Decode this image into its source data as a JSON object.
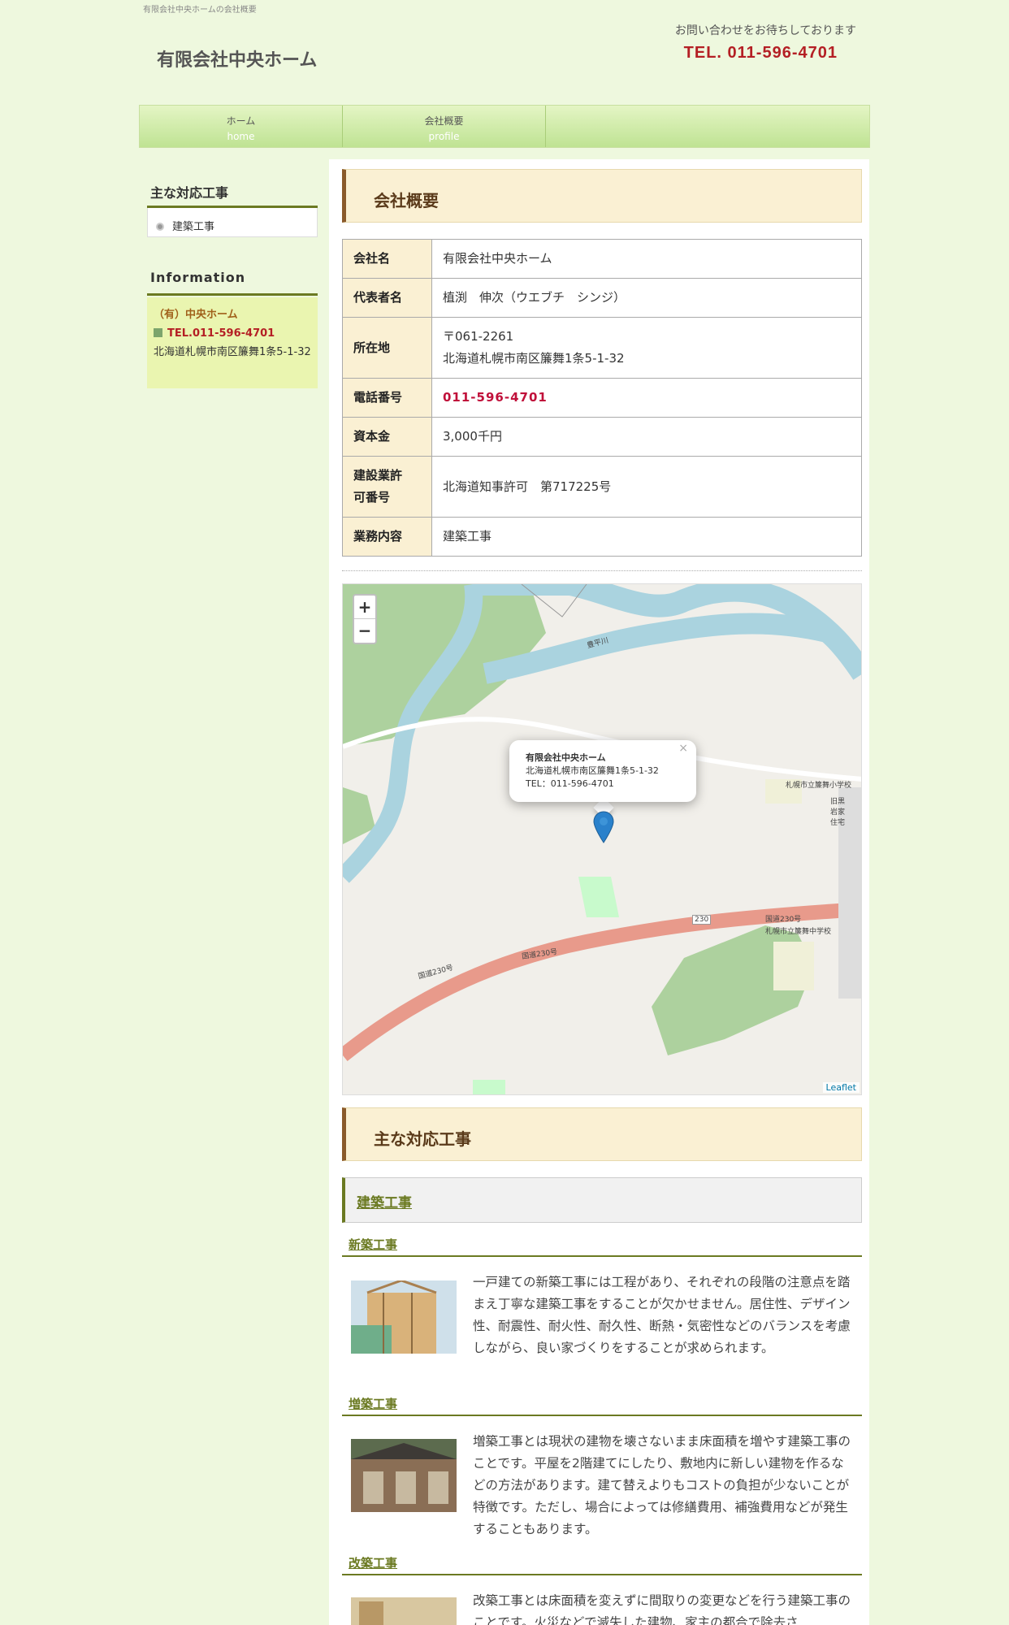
{
  "header": {
    "topline": "有限会社中央ホームの会社概要",
    "site_title": "有限会社中央ホーム",
    "contact_message": "お問い合わせをお待ちしております",
    "contact_tel": "TEL. 011-596-4701"
  },
  "nav": [
    {
      "label": "ホーム",
      "sub": "home"
    },
    {
      "label": "会社概要",
      "sub": "profile"
    }
  ],
  "sidebar": {
    "works_heading": "主な対応工事",
    "works_items": [
      "建築工事"
    ],
    "info_heading": "Information",
    "info_company": "（有）中央ホーム",
    "info_tel": "TEL.011-596-4701",
    "info_address": "北海道札幌市南区簾舞1条5-1-32"
  },
  "profile": {
    "heading": "会社概要",
    "rows": [
      {
        "label": "会社名",
        "value": "有限会社中央ホーム"
      },
      {
        "label": "代表者名",
        "value": "植渕　伸次（ウエブチ　シンジ）"
      },
      {
        "label": "所在地",
        "value": "〒061-2261",
        "value2": "北海道札幌市南区簾舞1条5-1-32"
      },
      {
        "label": "電話番号",
        "value": "011-596-4701"
      },
      {
        "label": "資本金",
        "value": "3,000千円"
      },
      {
        "label": "建設業許",
        "label2": "可番号",
        "value": "北海道知事許可　第717225号"
      },
      {
        "label": "業務内容",
        "value": "建築工事"
      }
    ]
  },
  "map": {
    "zoom_in": "+",
    "zoom_out": "−",
    "popup_title": "有限会社中央ホーム",
    "popup_address": "北海道札幌市南区簾舞1条5-1-32",
    "popup_tel": "TEL：011-596-4701",
    "popup_close": "×",
    "attribution": "Leaflet",
    "labels": {
      "route1": "国道230号",
      "route2": "国道230号",
      "route3": "国道230号",
      "route_shield": "230",
      "river": "豊平川",
      "school1": "札幌市立簾舞小学校",
      "school2": "札幌市立簾舞中学校",
      "house": "旧黒岩家住宅"
    }
  },
  "works": {
    "heading": "主な対応工事",
    "category": "建築工事",
    "items": [
      {
        "title": "新築工事",
        "text": "一戸建ての新築工事には工程があり、それぞれの段階の注意点を踏まえ丁寧な建築工事をすることが欠かせません。居住性、デザイン性、耐震性、耐火性、耐久性、断熱・気密性などのバランスを考慮しながら、良い家づくりをすることが求められます。"
      },
      {
        "title": "増築工事",
        "text": "増築工事とは現状の建物を壊さないまま床面積を増やす建築工事のことです。平屋を2階建てにしたり、敷地内に新しい建物を作るなどの方法があります。建て替えよりもコストの負担が少ないことが特徴です。ただし、場合によっては修繕費用、補強費用などが発生することもあります。"
      },
      {
        "title": "改築工事",
        "text": "改築工事とは床面積を変えずに間取りの変更などを行う建築工事のことです。火災などで滅失した建物、家主の都合で除去さ"
      }
    ]
  },
  "colors": {
    "background": "#eef8de",
    "accent_red": "#b41f24",
    "olive": "#6b7a22",
    "heading_bg": "#faf0d3"
  }
}
